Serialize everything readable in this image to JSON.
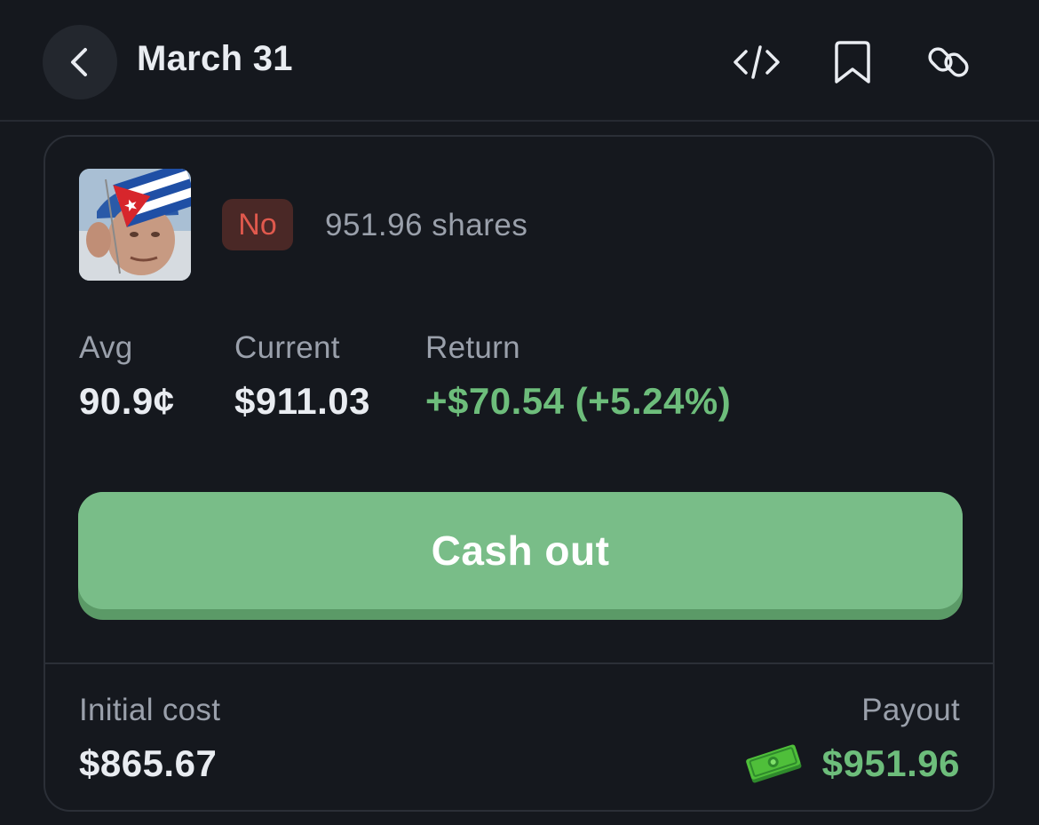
{
  "header": {
    "title": "March 31",
    "back_icon": "chevron-left-icon",
    "actions": [
      {
        "icon": "code-icon"
      },
      {
        "icon": "bookmark-icon"
      },
      {
        "icon": "link-icon"
      }
    ]
  },
  "position": {
    "image": "market-thumbnail",
    "outcome_badge": "No",
    "shares": "951.96 shares",
    "stats": [
      {
        "label": "Avg",
        "value": "90.9¢"
      },
      {
        "label": "Current",
        "value": "$911.03"
      },
      {
        "label": "Return",
        "value": "+$70.54 (+5.24%)"
      }
    ],
    "cash_out_label": "Cash out"
  },
  "footer": {
    "initial_cost_label": "Initial cost",
    "initial_cost_value": "$865.67",
    "payout_label": "Payout",
    "payout_icon": "money-icon",
    "payout_value": "$951.96"
  },
  "colors": {
    "background": "#15181e",
    "accent_green": "#79bd88",
    "return_green": "#6dbd7b",
    "badge_red": "#e0594d",
    "badge_bg": "#4a2826"
  }
}
